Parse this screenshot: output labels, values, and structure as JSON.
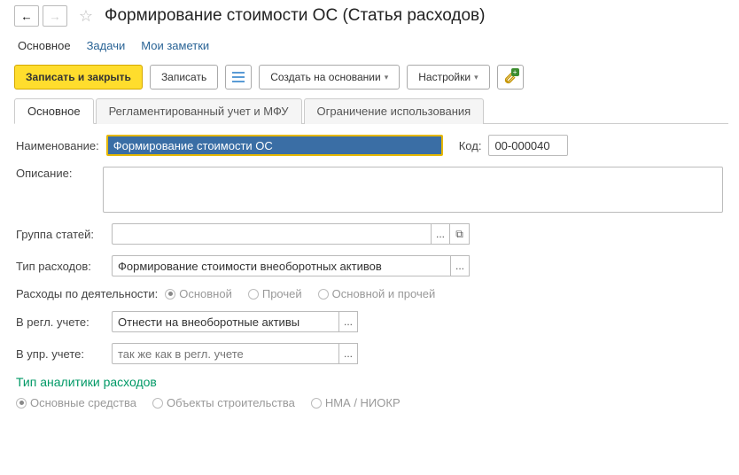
{
  "header": {
    "title": "Формирование стоимости ОС (Статья расходов)"
  },
  "top_tabs": [
    {
      "label": "Основное",
      "active": true
    },
    {
      "label": "Задачи",
      "active": false
    },
    {
      "label": "Мои заметки",
      "active": false
    }
  ],
  "toolbar": {
    "save_close": "Записать и закрыть",
    "save": "Записать",
    "create_based": "Создать на основании",
    "settings": "Настройки"
  },
  "inner_tabs": [
    {
      "label": "Основное",
      "active": true
    },
    {
      "label": "Регламентированный учет и МФУ",
      "active": false
    },
    {
      "label": "Ограничение использования",
      "active": false
    }
  ],
  "form": {
    "name_label": "Наименование:",
    "name_value": "Формирование стоимости ОС",
    "code_label": "Код:",
    "code_value": "00-000040",
    "desc_label": "Описание:",
    "desc_value": "",
    "group_label": "Группа статей:",
    "group_value": "",
    "type_label": "Тип расходов:",
    "type_value": "Формирование стоимости внеоборотных активов",
    "activity_label": "Расходы по деятельности:",
    "activity_options": [
      "Основной",
      "Прочей",
      "Основной и прочей"
    ],
    "activity_selected": 0,
    "regl_label": "В регл. учете:",
    "regl_value": "Отнести на внеоборотные активы",
    "upr_label": "В упр. учете:",
    "upr_placeholder": "так же как в регл. учете"
  },
  "analytics": {
    "title": "Тип аналитики расходов",
    "options": [
      "Основные средства",
      "Объекты строительства",
      "НМА / НИОКР"
    ],
    "selected": 0
  },
  "icons": {
    "back": "←",
    "forward": "→",
    "star": "☆",
    "caret": "▾",
    "ellipsis": "...",
    "popup": "⧉"
  }
}
